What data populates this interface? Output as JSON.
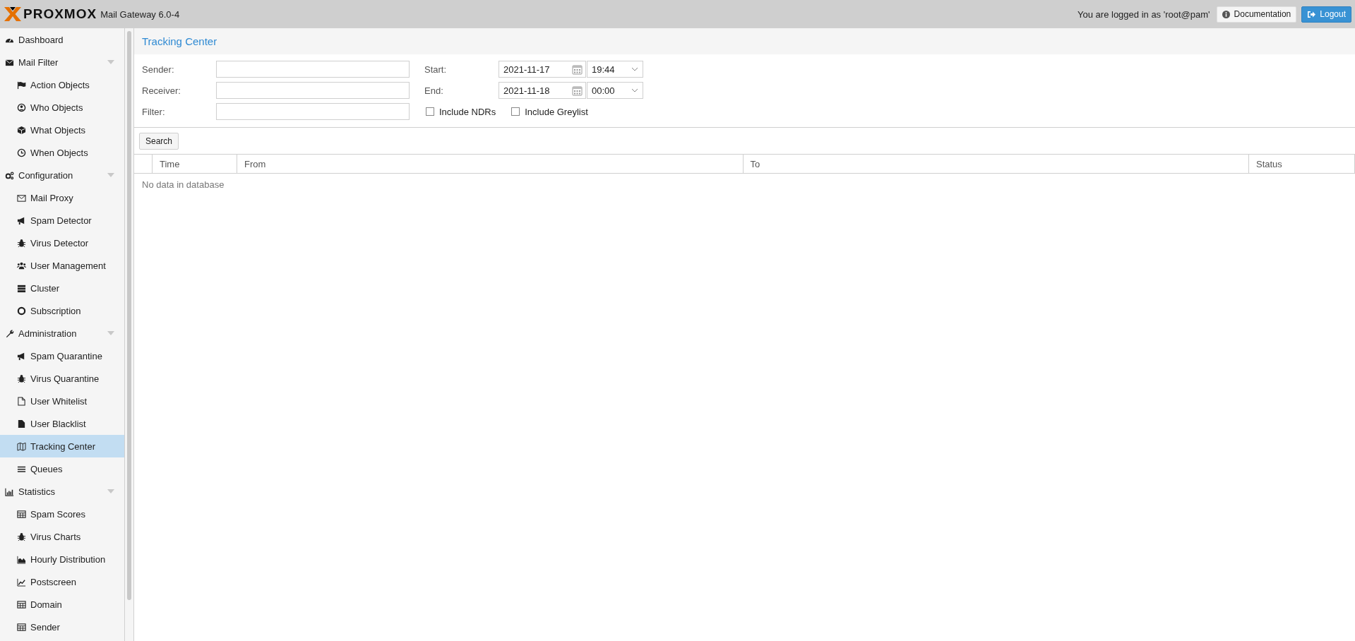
{
  "header": {
    "logo_text": "PROXMOX",
    "product": "Mail Gateway 6.0-4",
    "login_text": "You are logged in as 'root@pam'",
    "buttons": [
      {
        "label": "Documentation",
        "kind": "default"
      },
      {
        "label": "Logout",
        "kind": "primary"
      }
    ]
  },
  "sidebar": {
    "items": [
      {
        "label": "Dashboard",
        "selected": false
      },
      {
        "label": "Mail Filter",
        "selected": false,
        "expanded": true,
        "children": [
          {
            "label": "Action Objects",
            "selected": false
          },
          {
            "label": "Who Objects",
            "selected": false
          },
          {
            "label": "What Objects",
            "selected": false
          },
          {
            "label": "When Objects",
            "selected": false
          }
        ]
      },
      {
        "label": "Configuration",
        "selected": false,
        "expanded": true,
        "children": [
          {
            "label": "Mail Proxy",
            "selected": false
          },
          {
            "label": "Spam Detector",
            "selected": false
          },
          {
            "label": "Virus Detector",
            "selected": false
          },
          {
            "label": "User Management",
            "selected": false
          },
          {
            "label": "Cluster",
            "selected": false
          },
          {
            "label": "Subscription",
            "selected": false
          }
        ]
      },
      {
        "label": "Administration",
        "selected": false,
        "expanded": true,
        "children": [
          {
            "label": "Spam Quarantine",
            "selected": false
          },
          {
            "label": "Virus Quarantine",
            "selected": false
          },
          {
            "label": "User Whitelist",
            "selected": false
          },
          {
            "label": "User Blacklist",
            "selected": false
          },
          {
            "label": "Tracking Center",
            "selected": true
          },
          {
            "label": "Queues",
            "selected": false
          }
        ]
      },
      {
        "label": "Statistics",
        "selected": false,
        "expanded": true,
        "children": [
          {
            "label": "Spam Scores",
            "selected": false
          },
          {
            "label": "Virus Charts",
            "selected": false
          },
          {
            "label": "Hourly Distribution",
            "selected": false
          },
          {
            "label": "Postscreen",
            "selected": false
          },
          {
            "label": "Domain",
            "selected": false
          },
          {
            "label": "Sender",
            "selected": false
          }
        ]
      }
    ]
  },
  "panel": {
    "title": "Tracking Center",
    "text_fields": [
      {
        "label": "Sender:"
      },
      {
        "label": "Receiver:"
      },
      {
        "label": "Filter:"
      }
    ],
    "date_fields": [
      {
        "label": "Start:",
        "date": "2021-11-17",
        "time": "19:44"
      },
      {
        "label": "End:",
        "date": "2021-11-18",
        "time": "00:00"
      }
    ],
    "checkboxes": [
      {
        "label": "Include NDRs",
        "checked": false
      },
      {
        "label": "Include Greylist",
        "checked": false
      }
    ],
    "search_button": "Search",
    "table": {
      "columns": [
        "Time",
        "From",
        "To",
        "Status"
      ],
      "empty_text": "No data in database"
    }
  }
}
